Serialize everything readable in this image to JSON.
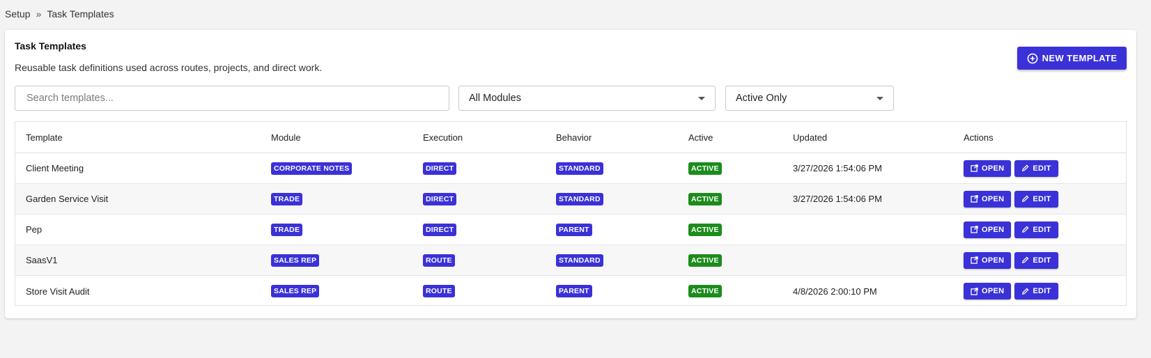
{
  "breadcrumb": {
    "root": "Setup",
    "separator": "»",
    "current": "Task Templates"
  },
  "header": {
    "title": "Task Templates",
    "description": "Reusable task definitions used across routes, projects, and direct work.",
    "new_button": "NEW TEMPLATE"
  },
  "filters": {
    "search_placeholder": "Search templates...",
    "search_value": "",
    "module_select": "All Modules",
    "active_select": "Active Only"
  },
  "table": {
    "columns": [
      "Template",
      "Module",
      "Execution",
      "Behavior",
      "Active",
      "Updated",
      "Actions"
    ],
    "rows": [
      {
        "template": "Client Meeting",
        "module": "CORPORATE NOTES",
        "execution": "DIRECT",
        "behavior": "STANDARD",
        "active": "ACTIVE",
        "updated": "3/27/2026 1:54:06 PM"
      },
      {
        "template": "Garden Service Visit",
        "module": "TRADE",
        "execution": "DIRECT",
        "behavior": "STANDARD",
        "active": "ACTIVE",
        "updated": "3/27/2026 1:54:06 PM"
      },
      {
        "template": "Pep",
        "module": "TRADE",
        "execution": "DIRECT",
        "behavior": "PARENT",
        "active": "ACTIVE",
        "updated": ""
      },
      {
        "template": "SaasV1",
        "module": "SALES REP",
        "execution": "ROUTE",
        "behavior": "STANDARD",
        "active": "ACTIVE",
        "updated": ""
      },
      {
        "template": "Store Visit Audit",
        "module": "SALES REP",
        "execution": "ROUTE",
        "behavior": "PARENT",
        "active": "ACTIVE",
        "updated": "4/8/2026 2:00:10 PM"
      }
    ],
    "open_label": "OPEN",
    "edit_label": "EDIT"
  },
  "colors": {
    "accent": "#3a31d8",
    "active_badge": "#1c8c1c",
    "background": "#f3f3f4"
  }
}
